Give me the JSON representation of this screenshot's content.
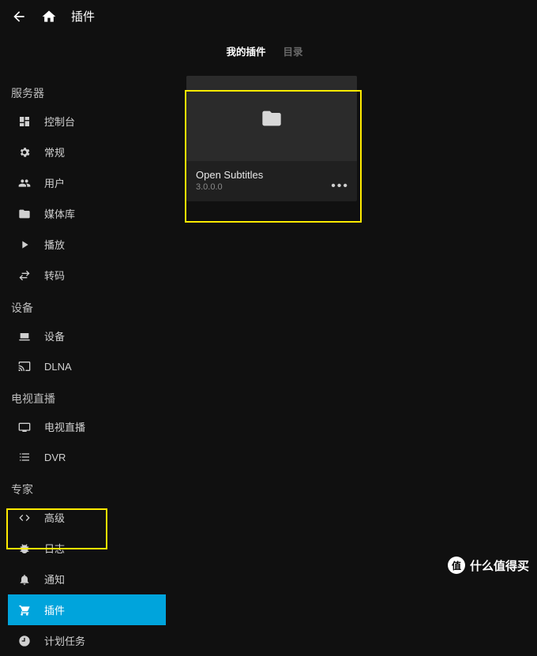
{
  "header": {
    "title": "插件"
  },
  "tabs": {
    "mine": "我的插件",
    "catalog": "目录"
  },
  "sidebar": {
    "sections": [
      {
        "title": "服务器",
        "items": [
          {
            "label": "控制台",
            "icon": "dashboard"
          },
          {
            "label": "常规",
            "icon": "gear"
          },
          {
            "label": "用户",
            "icon": "people"
          },
          {
            "label": "媒体库",
            "icon": "folder"
          },
          {
            "label": "播放",
            "icon": "play"
          },
          {
            "label": "转码",
            "icon": "swap"
          }
        ]
      },
      {
        "title": "设备",
        "items": [
          {
            "label": "设备",
            "icon": "laptop"
          },
          {
            "label": "DLNA",
            "icon": "input"
          }
        ]
      },
      {
        "title": "电视直播",
        "items": [
          {
            "label": "电视直播",
            "icon": "tv"
          },
          {
            "label": "DVR",
            "icon": "list"
          }
        ]
      },
      {
        "title": "专家",
        "items": [
          {
            "label": "高级",
            "icon": "code"
          },
          {
            "label": "日志",
            "icon": "bug"
          },
          {
            "label": "通知",
            "icon": "bell"
          },
          {
            "label": "插件",
            "icon": "cart",
            "active": true
          },
          {
            "label": "计划任务",
            "icon": "schedule"
          }
        ]
      }
    ]
  },
  "plugin": {
    "name": "Open Subtitles",
    "version": "3.0.0.0"
  },
  "watermark": {
    "badge": "值",
    "text": "什么值得买"
  }
}
